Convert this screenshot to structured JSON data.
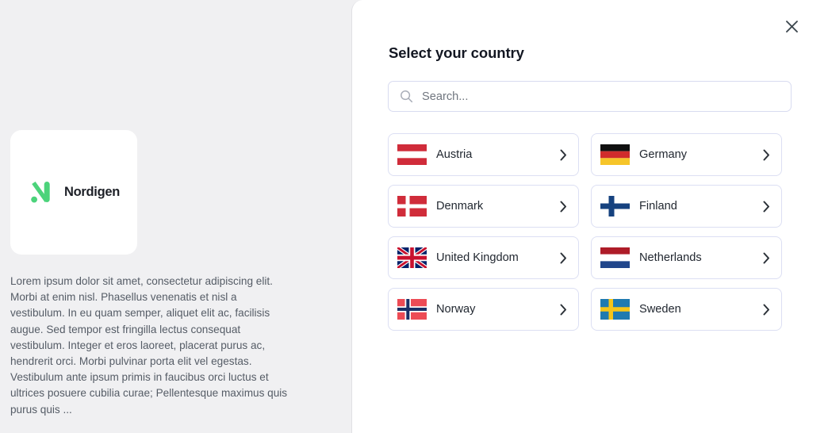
{
  "left": {
    "logo": {
      "mark_icon": "nordigen-n-icon",
      "wordmark": "Nordigen",
      "mark_color": "#4cd37b"
    },
    "description": "Lorem ipsum dolor sit amet, consectetur adipiscing elit. Morbi at enim nisl. Phasellus venenatis et nisl a vestibulum. In eu quam semper, aliquet elit ac, facilisis augue. Sed tempor est fringilla lectus consequat vestibulum. Integer et eros laoreet, placerat purus ac, hendrerit orci. Morbi pulvinar porta elit vel egestas. Vestibulum ante ipsum primis in faucibus orci luctus et ultrices posuere cubilia curae; Pellentesque maximus quis purus quis ...",
    "background_color": "#f0f0f2"
  },
  "panel": {
    "title": "Select your country",
    "close_icon": "close-icon",
    "background_color": "#ffffff"
  },
  "search": {
    "icon": "search-icon",
    "placeholder": "Search...",
    "value": ""
  },
  "countries": [
    {
      "name": "Austria",
      "flag": "flag-at",
      "chevron_icon": "chevron-right-icon"
    },
    {
      "name": "Germany",
      "flag": "flag-de",
      "chevron_icon": "chevron-right-icon"
    },
    {
      "name": "Denmark",
      "flag": "flag-dk",
      "chevron_icon": "chevron-right-icon"
    },
    {
      "name": "Finland",
      "flag": "flag-fi",
      "chevron_icon": "chevron-right-icon"
    },
    {
      "name": "United Kingdom",
      "flag": "flag-gb",
      "chevron_icon": "chevron-right-icon"
    },
    {
      "name": "Netherlands",
      "flag": "flag-nl",
      "chevron_icon": "chevron-right-icon"
    },
    {
      "name": "Norway",
      "flag": "flag-no",
      "chevron_icon": "chevron-right-icon"
    },
    {
      "name": "Sweden",
      "flag": "flag-se",
      "chevron_icon": "chevron-right-icon"
    }
  ],
  "colors": {
    "card_border": "#dcdff3",
    "text_primary": "#222831",
    "text_muted": "#555c66",
    "flag_red": "#d02c3a",
    "flag_blue": "#2b5ea7",
    "flag_yellow": "#f5c518"
  }
}
